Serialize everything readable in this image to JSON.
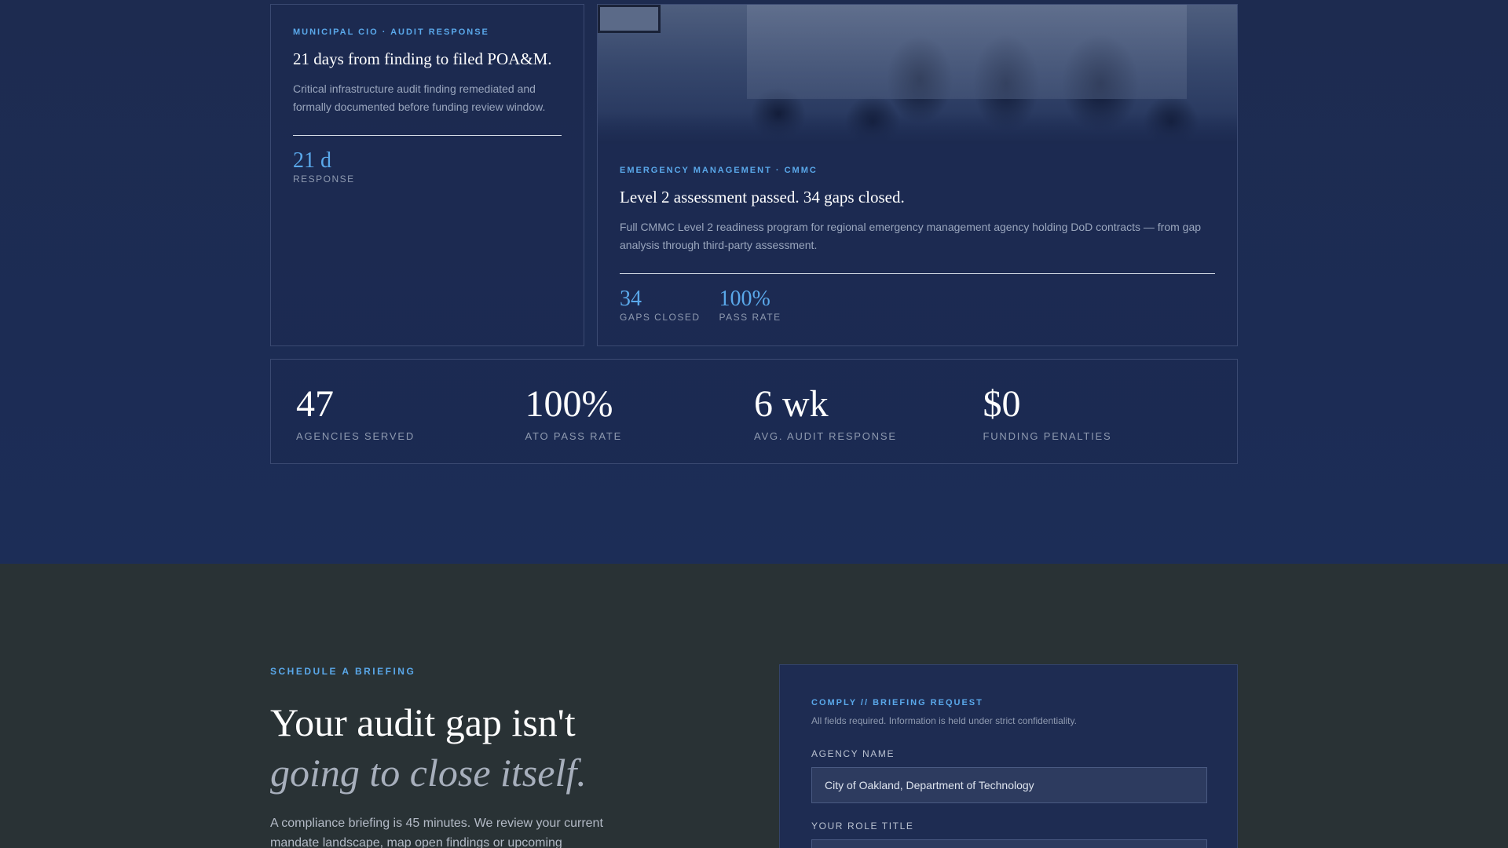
{
  "case_a": {
    "eyebrow": "MUNICIPAL CIO · AUDIT RESPONSE",
    "title": "21 days from finding to filed POA&M.",
    "description": "Critical infrastructure audit finding remediated and formally documented before funding review window.",
    "metrics": [
      {
        "value": "21 d",
        "label": "RESPONSE"
      }
    ]
  },
  "case_b": {
    "eyebrow": "EMERGENCY MANAGEMENT · CMMC",
    "title": "Level 2 assessment passed. 34 gaps closed.",
    "description": "Full CMMC Level 2 readiness program for regional emergency management agency holding DoD contracts — from gap analysis through third-party assessment.",
    "metrics": [
      {
        "value": "34",
        "label": "GAPS CLOSED"
      },
      {
        "value": "100%",
        "label": "PASS RATE"
      }
    ]
  },
  "stats": [
    {
      "value": "47",
      "label": "AGENCIES SERVED"
    },
    {
      "value": "100%",
      "label": "ATO PASS RATE"
    },
    {
      "value": "6 wk",
      "label": "AVG. AUDIT RESPONSE"
    },
    {
      "value": "$0",
      "label": "FUNDING PENALTIES"
    }
  ],
  "cta": {
    "eyebrow": "SCHEDULE A BRIEFING",
    "heading_line1": "Your audit gap isn't",
    "heading_line2": "going to close itself.",
    "body": "A compliance briefing is 45 minutes. We review your current mandate landscape, map open findings or upcoming"
  },
  "form": {
    "eyebrow": "COMPLY // BRIEFING REQUEST",
    "note": "All fields required. Information is held under strict confidentiality.",
    "agency_label": "AGENCY NAME",
    "agency_value": "City of Oakland, Department of Technology",
    "role_label": "YOUR ROLE TITLE"
  },
  "colors": {
    "accent": "#5aa8ea",
    "top_background": "#1c2d57",
    "bottom_background": "#293235"
  }
}
